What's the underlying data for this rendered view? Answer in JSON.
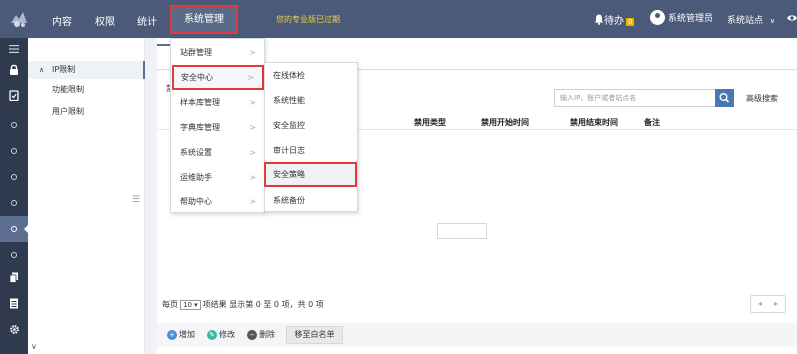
{
  "topnav": {
    "items": [
      "内容",
      "权限",
      "统计",
      "系统管理"
    ],
    "notice": "您的专业版已过期",
    "pending_label": "待办",
    "pending_count": "0",
    "user_label": "系统管理员",
    "site_label": "系统站点",
    "site_caret": "∨"
  },
  "sidebar2": {
    "items": [
      "IP限制",
      "功能限制",
      "用户限制"
    ],
    "caret": "∧",
    "collapse_icon": "☰",
    "bottom_arrow": "∨"
  },
  "main": {
    "stub_text": "禁",
    "search_placeholder": "输入IP、账户或者站点名",
    "adv_search": "高级搜索",
    "columns": [
      "禁用类型",
      "禁用开始时间",
      "禁用结束时间",
      "备注"
    ],
    "pager": {
      "prefix": "每页",
      "page_size": "10",
      "suffix": "项结果",
      "summary": "显示第 0 至 0 项，共 0 项",
      "prev": "◂",
      "next": "▸"
    },
    "actions": {
      "add": "增加",
      "edit": "修改",
      "delete": "删除",
      "whitelist": "移至白名单"
    }
  },
  "menu1": {
    "items": [
      "站群管理",
      "安全中心",
      "样本库管理",
      "字典库管理",
      "系统设置",
      "运维助手",
      "帮助中心"
    ],
    "arrow": ">"
  },
  "menu2": {
    "items": [
      "在线体检",
      "系统性能",
      "安全监控",
      "审计日志",
      "安全策略",
      "系统备份"
    ]
  },
  "colors": {
    "topnav_bg": "#4a5a78",
    "sidebar_bg": "#2f3a4f",
    "highlight_border": "#e23a3a",
    "accent": "#4a78b6",
    "notice": "#f5d33a"
  }
}
